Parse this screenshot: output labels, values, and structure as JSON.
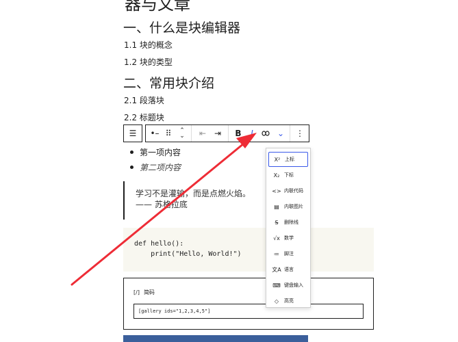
{
  "content": {
    "title_partial": "器与文章",
    "h2_1": "一、什么是块编辑器",
    "h3_1": "1.1 块的概念",
    "h3_2": "1.2 块的类型",
    "h2_2": "二、常用块介绍",
    "h3_3": "2.1 段落块",
    "h3_4": "2.2 标题块",
    "list": [
      "第一项内容",
      "第二项内容"
    ],
    "quote": {
      "line1": "学习不是灌输，而是点燃火焰。",
      "line2": "—— 苏格拉底"
    },
    "code": "def hello():\n    print(\"Hello, World!\")",
    "shortcode": {
      "label": "简码",
      "value": "[gallery ids=\"1,2,3,4,5\"]"
    }
  },
  "toolbar": {
    "buttons": [
      {
        "name": "block-type-icon",
        "glyph": "☰"
      },
      {
        "name": "drag-handle-icon",
        "glyph": "⠿"
      },
      {
        "name": "move-up-down-icon",
        "glyph": "⌃"
      },
      {
        "name": "outdent-icon",
        "glyph": "⇤"
      },
      {
        "name": "indent-icon",
        "glyph": "⇥"
      },
      {
        "name": "bold-button",
        "glyph": "B"
      },
      {
        "name": "italic-button",
        "glyph": "I"
      },
      {
        "name": "link-button",
        "glyph": "🔗"
      },
      {
        "name": "more-formats-chevron-icon",
        "glyph": "⌄"
      },
      {
        "name": "options-icon",
        "glyph": "⋮"
      }
    ]
  },
  "dropdown": {
    "items": [
      {
        "icon": "X²",
        "label": "上标"
      },
      {
        "icon": "X₂",
        "label": "下标"
      },
      {
        "icon": "<>",
        "label": "内联代码"
      },
      {
        "icon": "▤",
        "label": "内联图片"
      },
      {
        "icon": "S̶",
        "label": "删除线"
      },
      {
        "icon": "√x",
        "label": "数学"
      },
      {
        "icon": "≔",
        "label": "脚注"
      },
      {
        "icon": "文A",
        "label": "语言"
      },
      {
        "icon": "⌨",
        "label": "键盘输入"
      },
      {
        "icon": "◇",
        "label": "高亮"
      }
    ]
  },
  "colors": {
    "accent": "#3858e9",
    "arrow": "#ee2c36",
    "code_bg": "#f8f7f0"
  }
}
